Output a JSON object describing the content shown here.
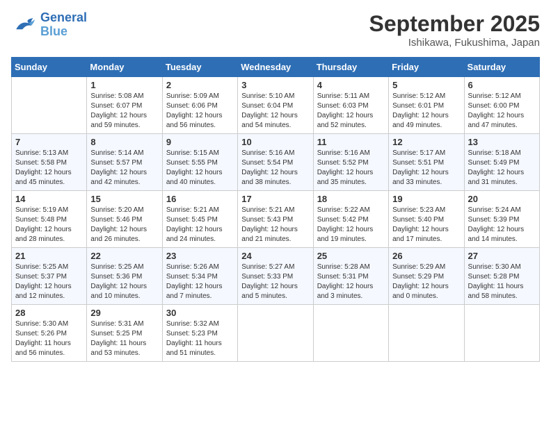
{
  "logo": {
    "line1": "General",
    "line2": "Blue"
  },
  "calendar": {
    "title": "September 2025",
    "subtitle": "Ishikawa, Fukushima, Japan"
  },
  "headers": [
    "Sunday",
    "Monday",
    "Tuesday",
    "Wednesday",
    "Thursday",
    "Friday",
    "Saturday"
  ],
  "weeks": [
    [
      {
        "day": "",
        "lines": []
      },
      {
        "day": "1",
        "lines": [
          "Sunrise: 5:08 AM",
          "Sunset: 6:07 PM",
          "Daylight: 12 hours",
          "and 59 minutes."
        ]
      },
      {
        "day": "2",
        "lines": [
          "Sunrise: 5:09 AM",
          "Sunset: 6:06 PM",
          "Daylight: 12 hours",
          "and 56 minutes."
        ]
      },
      {
        "day": "3",
        "lines": [
          "Sunrise: 5:10 AM",
          "Sunset: 6:04 PM",
          "Daylight: 12 hours",
          "and 54 minutes."
        ]
      },
      {
        "day": "4",
        "lines": [
          "Sunrise: 5:11 AM",
          "Sunset: 6:03 PM",
          "Daylight: 12 hours",
          "and 52 minutes."
        ]
      },
      {
        "day": "5",
        "lines": [
          "Sunrise: 5:12 AM",
          "Sunset: 6:01 PM",
          "Daylight: 12 hours",
          "and 49 minutes."
        ]
      },
      {
        "day": "6",
        "lines": [
          "Sunrise: 5:12 AM",
          "Sunset: 6:00 PM",
          "Daylight: 12 hours",
          "and 47 minutes."
        ]
      }
    ],
    [
      {
        "day": "7",
        "lines": [
          "Sunrise: 5:13 AM",
          "Sunset: 5:58 PM",
          "Daylight: 12 hours",
          "and 45 minutes."
        ]
      },
      {
        "day": "8",
        "lines": [
          "Sunrise: 5:14 AM",
          "Sunset: 5:57 PM",
          "Daylight: 12 hours",
          "and 42 minutes."
        ]
      },
      {
        "day": "9",
        "lines": [
          "Sunrise: 5:15 AM",
          "Sunset: 5:55 PM",
          "Daylight: 12 hours",
          "and 40 minutes."
        ]
      },
      {
        "day": "10",
        "lines": [
          "Sunrise: 5:16 AM",
          "Sunset: 5:54 PM",
          "Daylight: 12 hours",
          "and 38 minutes."
        ]
      },
      {
        "day": "11",
        "lines": [
          "Sunrise: 5:16 AM",
          "Sunset: 5:52 PM",
          "Daylight: 12 hours",
          "and 35 minutes."
        ]
      },
      {
        "day": "12",
        "lines": [
          "Sunrise: 5:17 AM",
          "Sunset: 5:51 PM",
          "Daylight: 12 hours",
          "and 33 minutes."
        ]
      },
      {
        "day": "13",
        "lines": [
          "Sunrise: 5:18 AM",
          "Sunset: 5:49 PM",
          "Daylight: 12 hours",
          "and 31 minutes."
        ]
      }
    ],
    [
      {
        "day": "14",
        "lines": [
          "Sunrise: 5:19 AM",
          "Sunset: 5:48 PM",
          "Daylight: 12 hours",
          "and 28 minutes."
        ]
      },
      {
        "day": "15",
        "lines": [
          "Sunrise: 5:20 AM",
          "Sunset: 5:46 PM",
          "Daylight: 12 hours",
          "and 26 minutes."
        ]
      },
      {
        "day": "16",
        "lines": [
          "Sunrise: 5:21 AM",
          "Sunset: 5:45 PM",
          "Daylight: 12 hours",
          "and 24 minutes."
        ]
      },
      {
        "day": "17",
        "lines": [
          "Sunrise: 5:21 AM",
          "Sunset: 5:43 PM",
          "Daylight: 12 hours",
          "and 21 minutes."
        ]
      },
      {
        "day": "18",
        "lines": [
          "Sunrise: 5:22 AM",
          "Sunset: 5:42 PM",
          "Daylight: 12 hours",
          "and 19 minutes."
        ]
      },
      {
        "day": "19",
        "lines": [
          "Sunrise: 5:23 AM",
          "Sunset: 5:40 PM",
          "Daylight: 12 hours",
          "and 17 minutes."
        ]
      },
      {
        "day": "20",
        "lines": [
          "Sunrise: 5:24 AM",
          "Sunset: 5:39 PM",
          "Daylight: 12 hours",
          "and 14 minutes."
        ]
      }
    ],
    [
      {
        "day": "21",
        "lines": [
          "Sunrise: 5:25 AM",
          "Sunset: 5:37 PM",
          "Daylight: 12 hours",
          "and 12 minutes."
        ]
      },
      {
        "day": "22",
        "lines": [
          "Sunrise: 5:25 AM",
          "Sunset: 5:36 PM",
          "Daylight: 12 hours",
          "and 10 minutes."
        ]
      },
      {
        "day": "23",
        "lines": [
          "Sunrise: 5:26 AM",
          "Sunset: 5:34 PM",
          "Daylight: 12 hours",
          "and 7 minutes."
        ]
      },
      {
        "day": "24",
        "lines": [
          "Sunrise: 5:27 AM",
          "Sunset: 5:33 PM",
          "Daylight: 12 hours",
          "and 5 minutes."
        ]
      },
      {
        "day": "25",
        "lines": [
          "Sunrise: 5:28 AM",
          "Sunset: 5:31 PM",
          "Daylight: 12 hours",
          "and 3 minutes."
        ]
      },
      {
        "day": "26",
        "lines": [
          "Sunrise: 5:29 AM",
          "Sunset: 5:29 PM",
          "Daylight: 12 hours",
          "and 0 minutes."
        ]
      },
      {
        "day": "27",
        "lines": [
          "Sunrise: 5:30 AM",
          "Sunset: 5:28 PM",
          "Daylight: 11 hours",
          "and 58 minutes."
        ]
      }
    ],
    [
      {
        "day": "28",
        "lines": [
          "Sunrise: 5:30 AM",
          "Sunset: 5:26 PM",
          "Daylight: 11 hours",
          "and 56 minutes."
        ]
      },
      {
        "day": "29",
        "lines": [
          "Sunrise: 5:31 AM",
          "Sunset: 5:25 PM",
          "Daylight: 11 hours",
          "and 53 minutes."
        ]
      },
      {
        "day": "30",
        "lines": [
          "Sunrise: 5:32 AM",
          "Sunset: 5:23 PM",
          "Daylight: 11 hours",
          "and 51 minutes."
        ]
      },
      {
        "day": "",
        "lines": []
      },
      {
        "day": "",
        "lines": []
      },
      {
        "day": "",
        "lines": []
      },
      {
        "day": "",
        "lines": []
      }
    ]
  ]
}
